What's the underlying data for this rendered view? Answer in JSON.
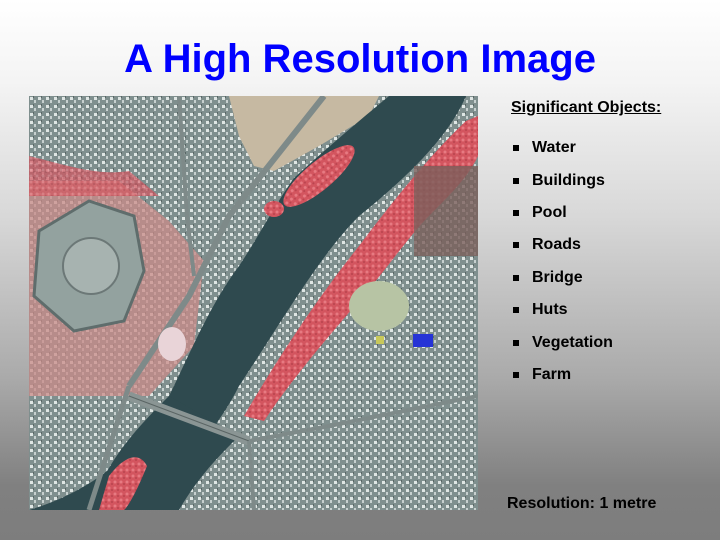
{
  "slide": {
    "title": "A High Resolution Image",
    "image": {
      "description": "False-colour satellite image of a river with islands, bridge, roads and urban areas",
      "alt": "Satellite image"
    },
    "sidebar": {
      "heading": "Significant Objects:",
      "items": [
        {
          "label": "Water"
        },
        {
          "label": "Buildings"
        },
        {
          "label": "Pool"
        },
        {
          "label": "Roads"
        },
        {
          "label": "Bridge"
        },
        {
          "label": "Huts"
        },
        {
          "label": "Vegetation"
        },
        {
          "label": "Farm"
        }
      ]
    },
    "resolution": "Resolution: 1 metre"
  },
  "colors": {
    "title": "#0000ff",
    "water": "#2f4a4f",
    "vegetation": "#d9606a",
    "urban": "#9aa7a6",
    "pool": "#2533d6"
  }
}
